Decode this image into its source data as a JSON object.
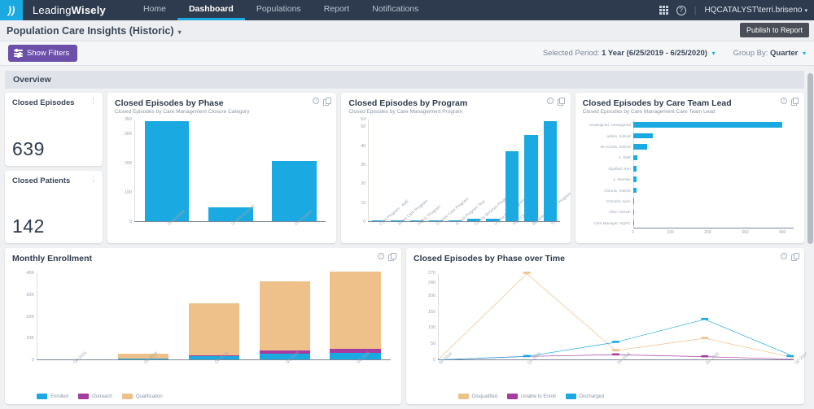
{
  "topnav": {
    "brand_light": "Leading",
    "brand_bold": "Wisely",
    "logo_icon": "flame-icon",
    "items": [
      {
        "label": "Home",
        "active": false
      },
      {
        "label": "Dashboard",
        "active": true
      },
      {
        "label": "Populations",
        "active": false
      },
      {
        "label": "Report",
        "active": false
      },
      {
        "label": "Notifications",
        "active": false
      }
    ],
    "apps_icon": "grid-icon",
    "help_icon": "help-circle-icon",
    "separator": "|",
    "user": "HQCATALYST\\terri.briseno",
    "caret": "▾"
  },
  "titlebar": {
    "dashboard_name": "Population Care Insights (Historic)",
    "caret": "▾",
    "publish_label": "Publish to Report"
  },
  "filterbar": {
    "show_filters_label": "Show Filters",
    "filters_icon": "sliders-icon",
    "selected_period_label": "Selected Period:",
    "selected_period_value": "1 Year (6/25/2019 - 6/25/2020)",
    "group_by_label": "Group By:",
    "group_by_value": "Quarter",
    "caret": "▾"
  },
  "overview": {
    "section_label": "Overview"
  },
  "kpis": [
    {
      "label": "Closed Episodes",
      "value": "639",
      "menu_icon": "kebab-menu-icon"
    },
    {
      "label": "Closed Patients",
      "value": "142",
      "menu_icon": "kebab-menu-icon"
    }
  ],
  "card_icons": {
    "info": "info-icon",
    "copy": "copy-icon"
  },
  "chart_data": [
    {
      "type": "bar",
      "title": "Closed Episodes by Phase",
      "subtitle": "Closed Episodes by Care Management Closure Category",
      "categories": [
        "Disqualified",
        "Unable to Enroll",
        "Discharged"
      ],
      "values": [
        345,
        48,
        208
      ],
      "xlabel": "",
      "ylabel": "",
      "yticks": [
        "350",
        "300",
        "200",
        "100",
        "0"
      ],
      "ylim": [
        0,
        350
      ],
      "color": "#1aa9e1",
      "grid": false,
      "legend": "none"
    },
    {
      "type": "bar",
      "title": "Closed Episodes by Program",
      "subtitle": "Closed Episodes by Care Management Program",
      "categories": [
        "Care Program - A&E",
        "Direct Care Program",
        "HQHC Program",
        "Chronic Care Program",
        "A Trial Program Test",
        "Cutera Services Program",
        "Urgent Care Program",
        "High CID",
        "Behavioral Health Program",
        "Tri-B"
      ],
      "values": [
        0.5,
        0.5,
        0.5,
        0.5,
        0.5,
        1.5,
        1.5,
        37,
        46,
        53
      ],
      "xlabel": "",
      "ylabel": "",
      "yticks": [
        "54",
        "50",
        "40",
        "30",
        "20",
        "10",
        "0"
      ],
      "ylim": [
        0,
        54
      ],
      "color": "#1aa9e1",
      "grid": false,
      "legend": "none"
    },
    {
      "type": "bar",
      "orientation": "horizontal",
      "title": "Closed Episodes by Care Team Lead",
      "subtitle": "Closed Episodes by Care Management Care Team Lead",
      "categories": [
        "Unassigned, Unassigned",
        "admin, Kismet",
        "All Access, Kismet",
        "1, Staff",
        "Algofied, Run",
        "1, Akuntas",
        "Chronic, Kismet",
        "Chemist, Apex",
        "Allen, Denah",
        "Care Manager, HQHC"
      ],
      "values": [
        400,
        52,
        38,
        11,
        9,
        9,
        9,
        3,
        1,
        1
      ],
      "xticks": [
        "0",
        "100",
        "200",
        "300",
        "400"
      ],
      "xlim": [
        0,
        430
      ],
      "color": "#1aa9e1",
      "grid": false,
      "legend": "none"
    },
    {
      "type": "bar",
      "stacked": true,
      "title": "Monthly Enrollment",
      "subtitle": "",
      "categories": [
        "Q2-2019",
        "Q3-2019",
        "Q4-2019",
        "Q1-2020",
        "Q2-2020"
      ],
      "series": [
        {
          "name": "Enrolled",
          "color": "#1aa9e1",
          "values": [
            0,
            300,
            1600,
            2800,
            3000
          ]
        },
        {
          "name": "Outreach",
          "color": "#a63d9e",
          "values": [
            0,
            150,
            300,
            1300,
            1900
          ]
        },
        {
          "name": "Qualification",
          "color": "#eec18b",
          "values": [
            0,
            2050,
            24100,
            32000,
            35900
          ]
        }
      ],
      "yticks": [
        "40K",
        "30K",
        "20K",
        "10K",
        "0"
      ],
      "ylim": [
        0,
        40000
      ],
      "xlabel": "",
      "ylabel": "",
      "grid": false,
      "legend": "bottom"
    },
    {
      "type": "line",
      "title": "Closed Episodes by Phase over Time",
      "subtitle": "",
      "x": [
        "Q2-2019",
        "Q3-2019",
        "Q4-2019",
        "Q1-2020",
        "Q2-2020"
      ],
      "series": [
        {
          "name": "Disqualified",
          "color": "#eec18b",
          "values": [
            1,
            268,
            30,
            68,
            8
          ]
        },
        {
          "name": "Unable to Enroll",
          "color": "#a63d9e",
          "values": [
            1,
            12,
            17,
            11,
            3
          ]
        },
        {
          "name": "Discharged",
          "color": "#1aa9e1",
          "values": [
            1,
            12,
            56,
            127,
            12
          ]
        }
      ],
      "yticks": [
        "270",
        "240",
        "200",
        "150",
        "100",
        "50",
        "0"
      ],
      "ylim": [
        0,
        270
      ],
      "xlabel": "",
      "ylabel": "",
      "grid": false,
      "legend": "bottom"
    }
  ]
}
